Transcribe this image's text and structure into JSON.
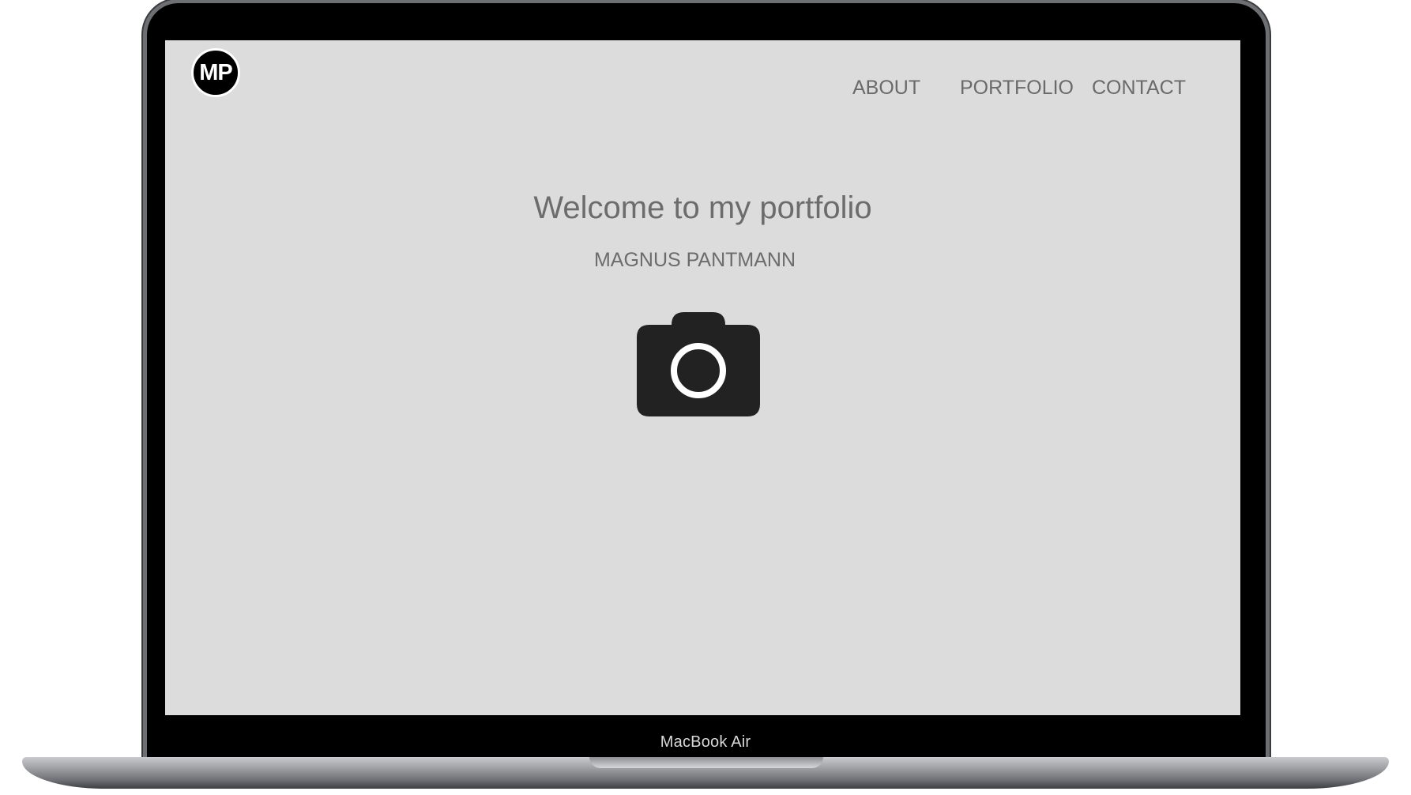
{
  "device": {
    "model_label": "MacBook Air"
  },
  "site": {
    "logo_text": "MP",
    "nav": [
      {
        "label": "ABOUT"
      },
      {
        "label": "PORTFOLIO"
      },
      {
        "label": "CONTACT"
      }
    ],
    "hero": {
      "title": "Welcome to my portfolio",
      "subtitle": "MAGNUS PANTMANN",
      "icon": "camera-icon"
    }
  },
  "colors": {
    "screen_background": "#dcdcdc",
    "text": "#6c6c6c",
    "logo_background": "#000000",
    "icon": "#222222"
  }
}
